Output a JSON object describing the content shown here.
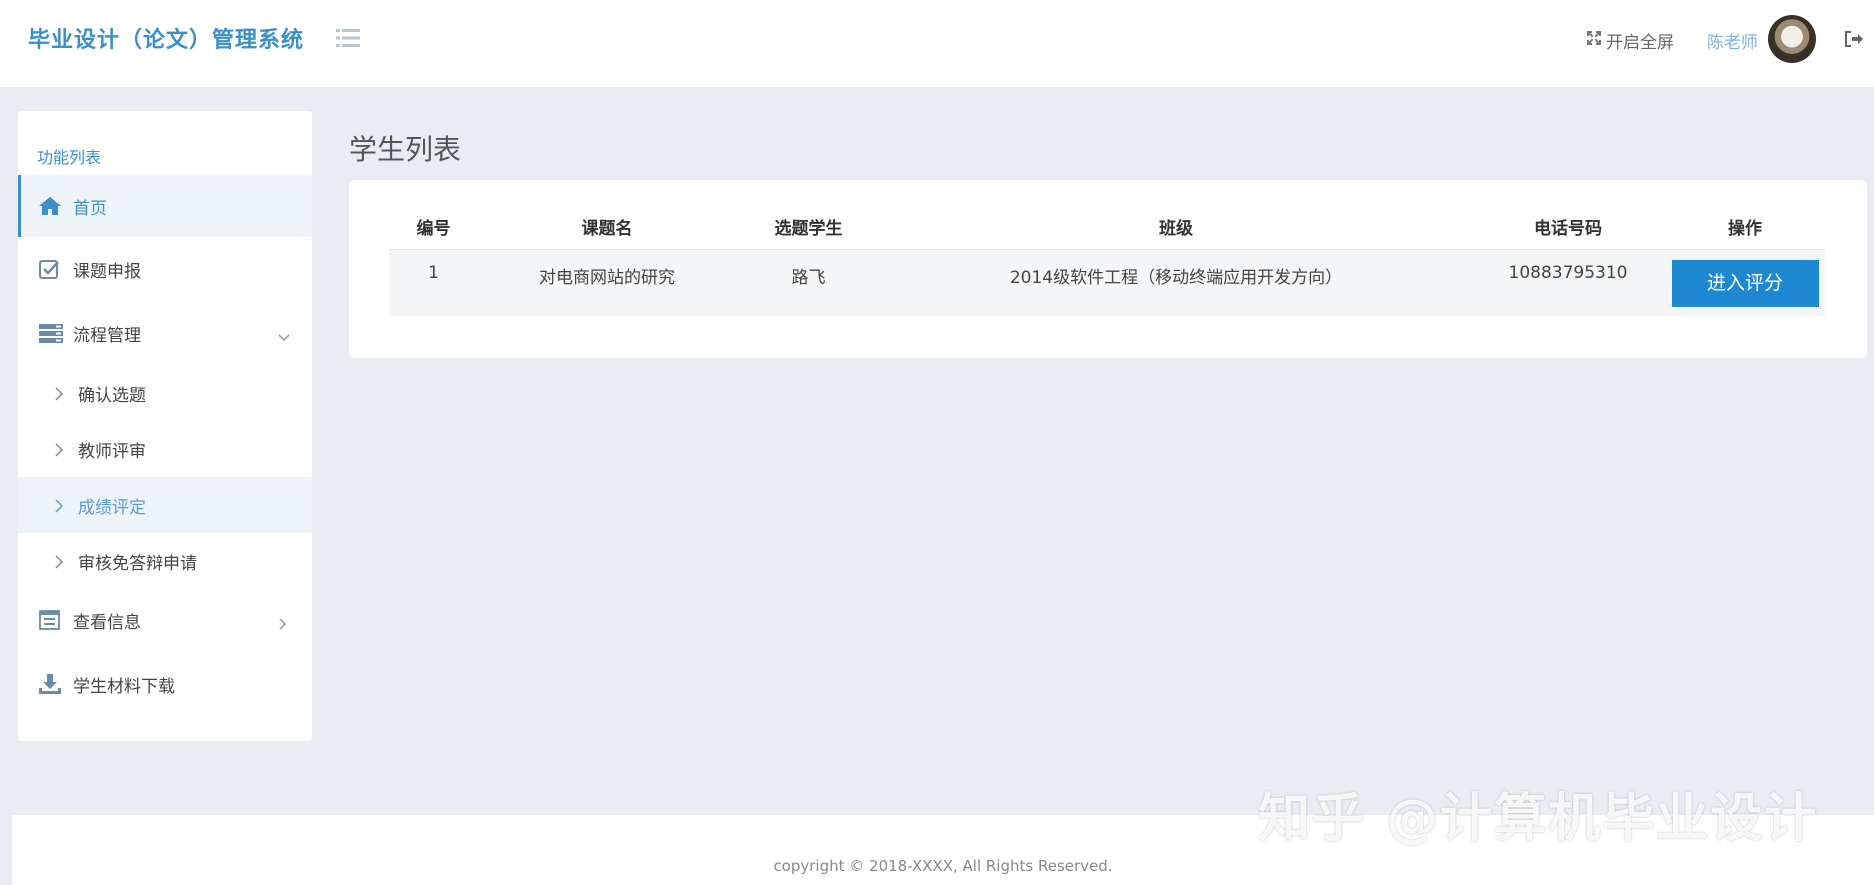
{
  "header": {
    "brand": "毕业设计（论文）管理系统",
    "fullscreen_label": "开启全屏",
    "username": "陈老师"
  },
  "sidebar": {
    "title": "功能列表",
    "items": [
      {
        "label": "首页"
      },
      {
        "label": "课题申报"
      },
      {
        "label": "流程管理"
      },
      {
        "label": "查看信息"
      },
      {
        "label": "学生材料下载"
      }
    ],
    "sub_items": [
      {
        "label": "确认选题"
      },
      {
        "label": "教师评审"
      },
      {
        "label": "成绩评定"
      },
      {
        "label": "审核免答辩申请"
      }
    ]
  },
  "main": {
    "page_title": "学生列表",
    "table": {
      "columns": [
        "编号",
        "课题名",
        "选题学生",
        "班级",
        "电话号码",
        "操作"
      ],
      "rows": [
        {
          "id": "1",
          "topic": "对电商网站的研究",
          "student": "路飞",
          "class": "2014级软件工程（移动终端应用开发方向）",
          "phone": "10883795310",
          "action": "进入评分"
        }
      ]
    }
  },
  "footer": {
    "copyright": "copyright © 2018-XXXX, All Rights Reserved."
  },
  "watermark": "知乎 @计算机毕业设计",
  "colors": {
    "accent": "#3a8fc9",
    "button": "#1e88d2",
    "background": "#e9edf3"
  }
}
